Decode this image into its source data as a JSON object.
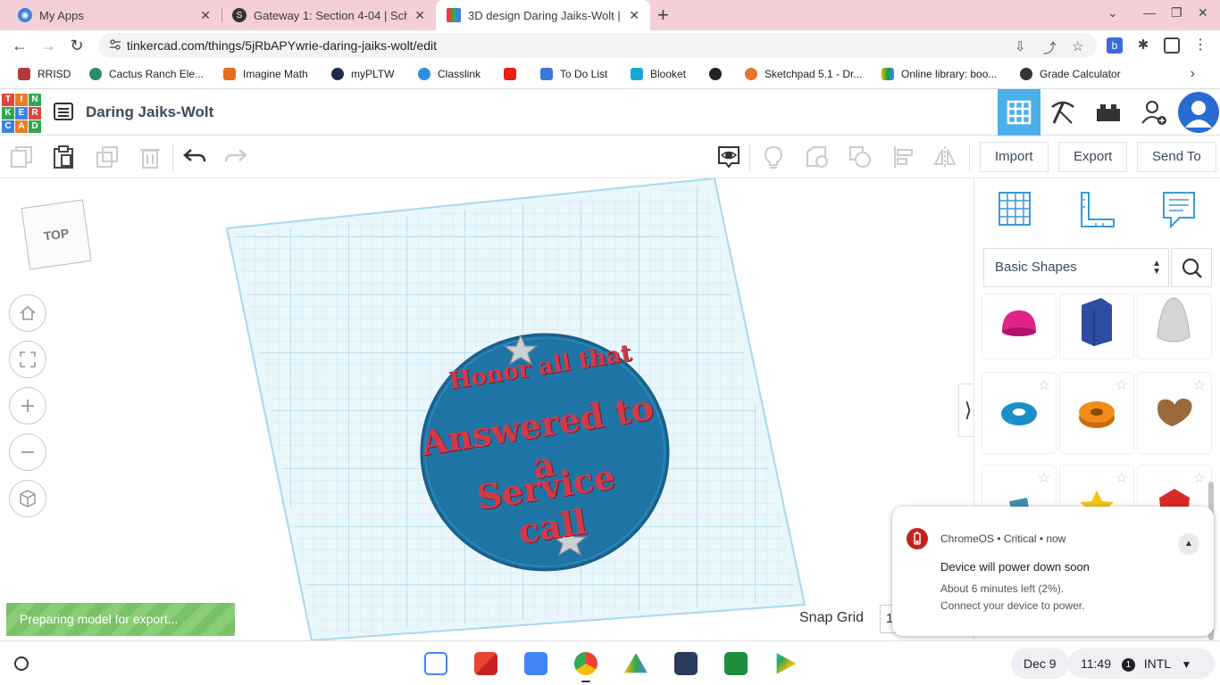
{
  "browser": {
    "tabs": [
      {
        "title": "My Apps",
        "icon": "my-apps-icon"
      },
      {
        "title": "Gateway 1: Section 4-04 | School...",
        "icon": "schoology-icon"
      },
      {
        "title": "3D design Daring Jaiks-Wolt | Tin...",
        "icon": "tinkercad-icon"
      }
    ],
    "url": "tinkercad.com/things/5jRbAPYwrie-daring-jaiks-wolt/edit",
    "bookmarks": [
      "RRISD",
      "Cactus Ranch Ele...",
      "Imagine Math",
      "myPLTW",
      "Classlink",
      "",
      "To Do List",
      "Blooket",
      "",
      "Sketchpad 5.1 - Dr...",
      "Online library: boo...",
      "Grade Calculator"
    ]
  },
  "tinkercad": {
    "logo_letters": [
      "T",
      "I",
      "N",
      "K",
      "E",
      "R",
      "C",
      "A",
      "D"
    ],
    "design_title": "Daring Jaiks-Wolt",
    "actions": {
      "import": "Import",
      "export": "Export",
      "send_to": "Send To"
    },
    "viewcube_label": "TOP",
    "status": "Preparing model for export...",
    "snap_grid_label": "Snap Grid",
    "snap_grid_value": "1",
    "shape_library": "Basic Shapes",
    "model_text": [
      "Honor all that",
      "Answered to a",
      "Service call"
    ],
    "shapes": [
      {
        "name": "half-sphere",
        "color": "#e0238a"
      },
      {
        "name": "polygon",
        "color": "#2d4da3"
      },
      {
        "name": "paraboloid",
        "color": "#d6d6d6"
      },
      {
        "name": "torus",
        "color": "#1a8fc9"
      },
      {
        "name": "tube",
        "color": "#f08b1c"
      },
      {
        "name": "heart",
        "color": "#9b6a3c"
      },
      {
        "name": "wedge-partial",
        "color": "#3b8fb0"
      },
      {
        "name": "star",
        "color": "#f4c21a"
      },
      {
        "name": "icosahedron",
        "color": "#d92a2a"
      }
    ]
  },
  "notification": {
    "source": "ChromeOS",
    "severity": "Critical",
    "time": "now",
    "meta": "ChromeOS • Critical • now",
    "title": "Device will power down soon",
    "line1": "About 6 minutes left (2%).",
    "line2": "Connect your device to power."
  },
  "shelf": {
    "date": "Dec 9",
    "time": "11:49",
    "notif_count": "1",
    "input_method": "INTL"
  },
  "colors": {
    "accent": "#4cafea",
    "plate_blue": "#1f74a6",
    "text_red": "#d33a48",
    "status_green": "#7ac267"
  }
}
